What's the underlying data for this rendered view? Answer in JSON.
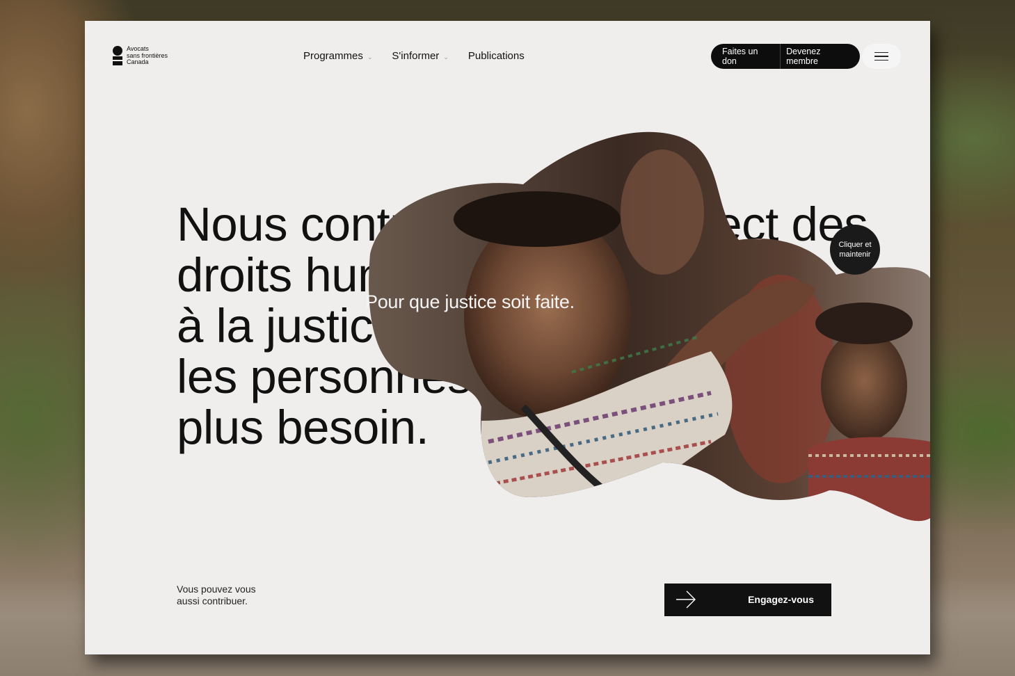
{
  "logo": {
    "lines": [
      "Avocats",
      "sans frontières",
      "Canada"
    ]
  },
  "nav": {
    "items": [
      {
        "label": "Programmes",
        "has_dropdown": true
      },
      {
        "label": "S'informer",
        "has_dropdown": true
      },
      {
        "label": "Publications",
        "has_dropdown": false
      }
    ],
    "dropdown_icon": "chevron-down-icon"
  },
  "header_actions": {
    "donate_label": "Faites un don",
    "member_label": "Devenez membre",
    "menu_icon": "hamburger-menu-icon"
  },
  "hero": {
    "headline_lines": [
      "Nous contribuons au respect des",
      "droits humains et à l'accès",
      "à la justice pour",
      "les personnes qui en ont le",
      "plus besoin."
    ],
    "overlay_text": "Pour que justice soit faite.",
    "hold_button_lines": [
      "Cliquer et",
      "maintenir"
    ]
  },
  "footer_cta": {
    "text_lines": [
      "Vous pouvez vous",
      "aussi contribuer."
    ],
    "button_label": "Engagez-vous",
    "button_icon": "arrow-right-icon"
  },
  "colors": {
    "card_background": "#efeeed",
    "primary": "#111111",
    "text_light": "#ffffff"
  }
}
